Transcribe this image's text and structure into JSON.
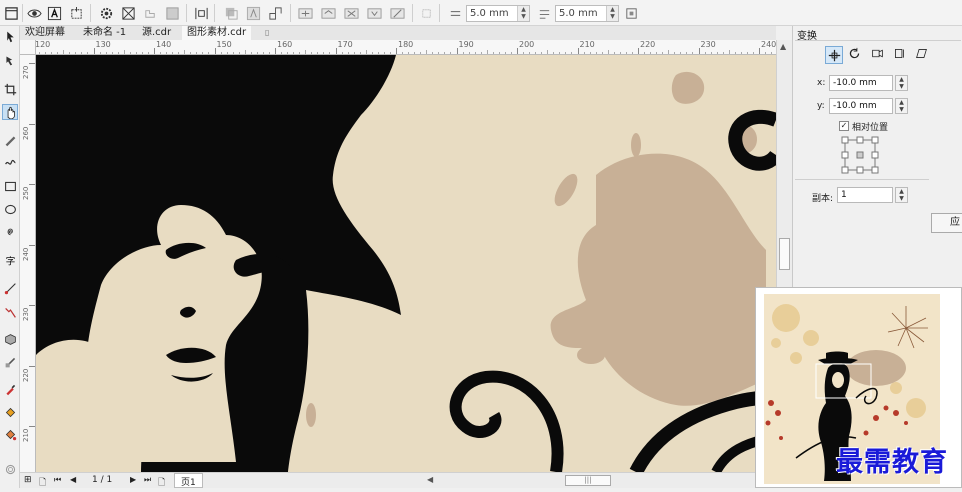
{
  "toolbar": {
    "offset_x": "5.0 mm",
    "offset_y": "5.0 mm"
  },
  "tabs": [
    {
      "label": "欢迎屏幕"
    },
    {
      "label": "未命名 -1"
    },
    {
      "label": "源.cdr"
    },
    {
      "label": "图形素材.cdr"
    }
  ],
  "ruler": {
    "h_ticks": [
      "120",
      "130",
      "140",
      "150",
      "160",
      "170",
      "180",
      "190",
      "200",
      "210",
      "220",
      "230",
      "240"
    ],
    "v_ticks": [
      "270",
      "260",
      "250",
      "240",
      "230",
      "220",
      "210"
    ]
  },
  "pagenav": {
    "page_counter": "1 / 1",
    "page_tab": "页1"
  },
  "docker": {
    "title": "变换",
    "x_label": "x:",
    "x_value": "-10.0 mm",
    "y_label": "y:",
    "y_value": "-10.0 mm",
    "relative_label": "相对位置",
    "relative_checked": "✓",
    "copies_label": "副本:",
    "copies_value": "1",
    "apply_label": "应"
  },
  "watermark": "最需教育",
  "colors": {
    "canvas_bg": "#e8dcc2",
    "splash": "#c8b096",
    "silhouette": "#0a0a0a"
  }
}
